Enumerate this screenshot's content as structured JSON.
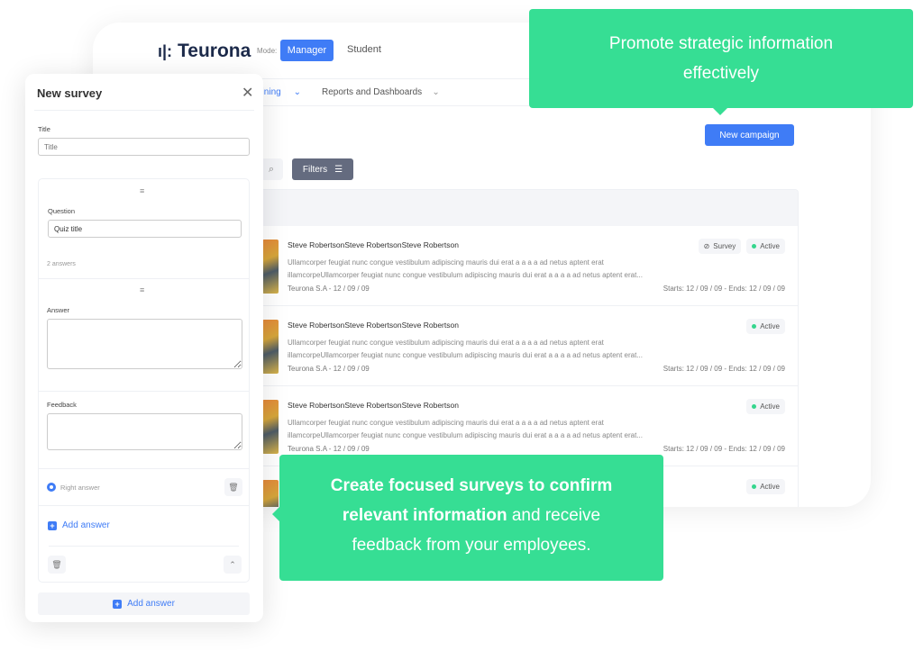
{
  "app": {
    "logo": "Teurona",
    "mode_label": "Mode:",
    "modes": [
      "Manager",
      "Student"
    ]
  },
  "nav": {
    "items": [
      "aining",
      "Reports and Dashboards"
    ]
  },
  "toolbar": {
    "new_campaign": "New campaign",
    "filters": "Filters"
  },
  "rows": [
    {
      "title": "Steve RobertsonSteve RobertsonSteve Robertson",
      "desc1": "Ullamcorper feugiat nunc congue vestibulum adipiscing mauris dui erat a a a a ad netus aptent erat",
      "desc2": "illamcorpeUllamcorper feugiat nunc congue vestibulum adipiscing mauris dui erat a a a a ad netus aptent erat...",
      "meta": "Teurona S.A - 12 / 09 / 09",
      "dates": "Starts: 12 / 09 / 09 - Ends: 12 / 09 / 09",
      "type": "Survey",
      "status": "Active"
    },
    {
      "title": "Steve RobertsonSteve RobertsonSteve Robertson",
      "desc1": "Ullamcorper feugiat nunc congue vestibulum adipiscing mauris dui erat a a a a ad netus aptent erat",
      "desc2": "illamcorpeUllamcorper feugiat nunc congue vestibulum adipiscing mauris dui erat a a a a ad netus aptent erat...",
      "meta": "Teurona S.A - 12 / 09 / 09",
      "dates": "Starts: 12 / 09 / 09 - Ends: 12 / 09 / 09",
      "status": "Active"
    },
    {
      "title": "Steve RobertsonSteve RobertsonSteve Robertson",
      "desc1": "Ullamcorper feugiat nunc congue vestibulum adipiscing mauris dui erat a a a a ad netus aptent erat",
      "desc2": "illamcorpeUllamcorper feugiat nunc congue vestibulum adipiscing mauris dui erat a a a a ad netus aptent erat...",
      "meta": "Teurona S.A - 12 / 09 / 09",
      "dates": "Starts: 12 / 09 / 09 - Ends: 12 / 09 / 09",
      "status": "Active"
    },
    {
      "status": "Active"
    }
  ],
  "panel": {
    "title": "New survey",
    "title_label": "Title",
    "title_placeholder": "Title",
    "question_label": "Question",
    "question_value": "Quiz title",
    "answers_count": "2 answers",
    "answer_label": "Answer",
    "feedback_label": "Feedback",
    "right_answer": "Right answer",
    "add_answer": "Add answer",
    "add_answer_bottom": "Add answer"
  },
  "callouts": {
    "top": "Promote strategic information effectively",
    "bottom_bold": "Create focused surveys to confirm relevant information",
    "bottom_rest": " and receive feedback from your employees."
  },
  "colors": {
    "primary": "#3f7cf6",
    "accent_green": "#36de94",
    "active_dot": "#36d68e"
  }
}
